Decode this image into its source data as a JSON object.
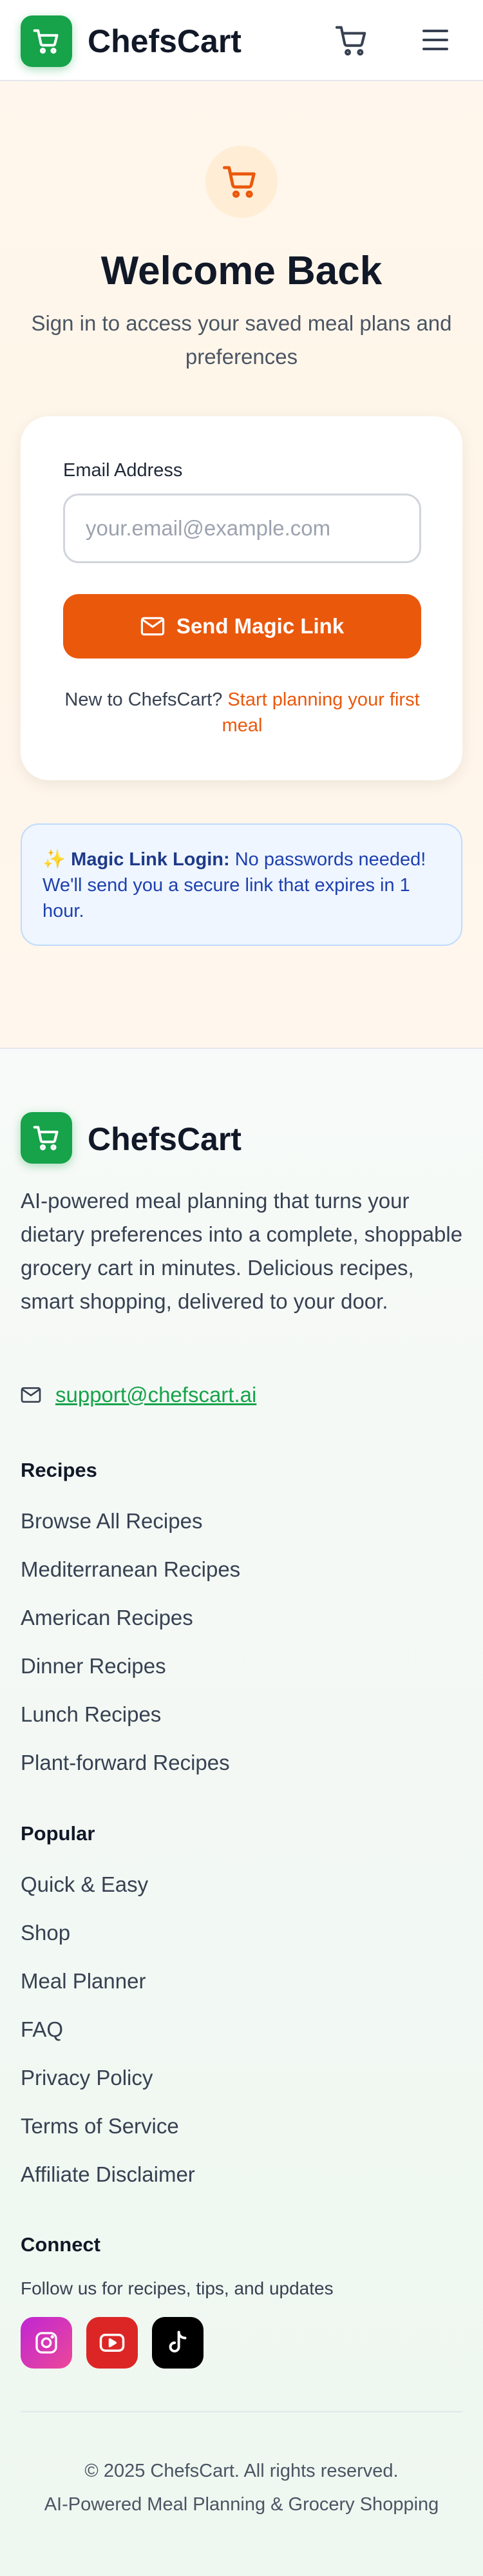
{
  "header": {
    "brand": "ChefsCart",
    "cart_icon": "shopping-cart-icon",
    "menu_icon": "hamburger-menu-icon"
  },
  "hero": {
    "icon": "shopping-cart-icon",
    "title": "Welcome Back",
    "subtitle": "Sign in to access your saved meal plans and preferences"
  },
  "login_card": {
    "email_label": "Email Address",
    "email_value": "",
    "email_placeholder": "your.email@example.com",
    "send_button_icon": "mail-icon",
    "send_button_label": "Send Magic Link",
    "signup_prefix": "New to ChefsCart? ",
    "signup_link": "Start planning your first meal"
  },
  "notice": {
    "icon": "✨",
    "title": "Magic Link Login:",
    "text": " No passwords needed! We'll send you a secure link that expires in 1 hour."
  },
  "footer": {
    "brand": "ChefsCart",
    "description": "AI-powered meal planning that turns your dietary preferences into a complete, shoppable grocery cart in minutes. Delicious recipes, smart shopping, delivered to your door.",
    "support_email": "support@chefscart.ai",
    "recipes": {
      "title": "Recipes",
      "links": [
        "Browse All Recipes",
        "Mediterranean Recipes",
        "American Recipes",
        "Dinner Recipes",
        "Lunch Recipes",
        "Plant-forward Recipes"
      ]
    },
    "popular": {
      "title": "Popular",
      "links": [
        "Quick & Easy",
        "Shop",
        "Meal Planner",
        "FAQ",
        "Privacy Policy",
        "Terms of Service",
        "Affiliate Disclaimer"
      ]
    },
    "connect": {
      "title": "Connect",
      "text": "Follow us for recipes, tips, and updates",
      "socials": [
        "instagram-icon",
        "youtube-icon",
        "tiktok-icon"
      ]
    },
    "copyright": "© 2025 ChefsCart. All rights reserved.",
    "tagline": "AI-Powered Meal Planning & Grocery Shopping"
  },
  "colors": {
    "brand_green": "#16a34a",
    "accent_orange": "#ea580c",
    "notice_blue": "#1e40af"
  }
}
